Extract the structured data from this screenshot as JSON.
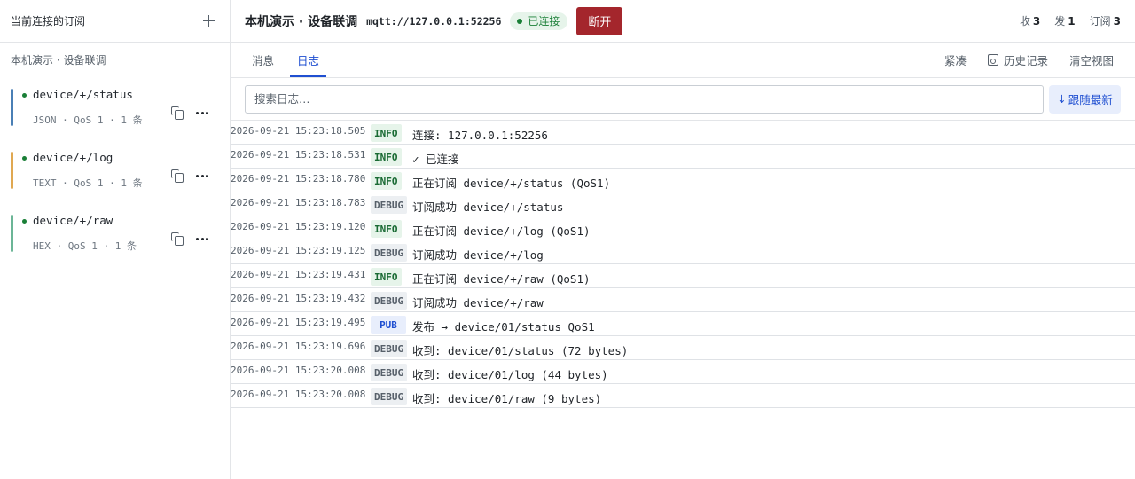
{
  "sidebar": {
    "title": "当前连接的订阅",
    "group_label": "本机演示 · 设备联调",
    "subscriptions": [
      {
        "topic": "device/+/status",
        "meta": "JSON · QoS 1 · 1 条",
        "color": "#4a7fb5"
      },
      {
        "topic": "device/+/log",
        "meta": "TEXT · QoS 1 · 1 条",
        "color": "#e0a851"
      },
      {
        "topic": "device/+/raw",
        "meta": "HEX · QoS 1 · 1 条",
        "color": "#6bb596"
      }
    ]
  },
  "header": {
    "connection_name": "本机演示 · 设备联调",
    "url": "mqtt://127.0.0.1:52256",
    "status": "已连接",
    "disconnect_label": "断开",
    "stats": {
      "recv_label": "收",
      "recv_value": "3",
      "send_label": "发",
      "send_value": "1",
      "sub_label": "订阅",
      "sub_value": "3"
    }
  },
  "tabs": {
    "messages": "消息",
    "log": "日志",
    "compact": "紧凑",
    "history": "历史记录",
    "clear": "清空视图"
  },
  "search": {
    "placeholder": "搜索日志…",
    "follow_label": "跟随最新"
  },
  "log": [
    {
      "ts": "2026-09-21 15:23:18.505",
      "level": "INFO",
      "msg": "连接: 127.0.0.1:52256"
    },
    {
      "ts": "2026-09-21 15:23:18.531",
      "level": "INFO",
      "msg": "✓ 已连接"
    },
    {
      "ts": "2026-09-21 15:23:18.780",
      "level": "INFO",
      "msg": "正在订阅 device/+/status (QoS1)"
    },
    {
      "ts": "2026-09-21 15:23:18.783",
      "level": "DEBUG",
      "msg": "订阅成功 device/+/status"
    },
    {
      "ts": "2026-09-21 15:23:19.120",
      "level": "INFO",
      "msg": "正在订阅 device/+/log (QoS1)"
    },
    {
      "ts": "2026-09-21 15:23:19.125",
      "level": "DEBUG",
      "msg": "订阅成功 device/+/log"
    },
    {
      "ts": "2026-09-21 15:23:19.431",
      "level": "INFO",
      "msg": "正在订阅 device/+/raw (QoS1)"
    },
    {
      "ts": "2026-09-21 15:23:19.432",
      "level": "DEBUG",
      "msg": "订阅成功 device/+/raw"
    },
    {
      "ts": "2026-09-21 15:23:19.495",
      "level": "PUB",
      "msg": "发布 → device/01/status QoS1"
    },
    {
      "ts": "2026-09-21 15:23:19.696",
      "level": "DEBUG",
      "msg": "收到: device/01/status (72 bytes)"
    },
    {
      "ts": "2026-09-21 15:23:20.008",
      "level": "DEBUG",
      "msg": "收到: device/01/log (44 bytes)"
    },
    {
      "ts": "2026-09-21 15:23:20.008",
      "level": "DEBUG",
      "msg": "收到: device/01/raw (9 bytes)"
    }
  ]
}
